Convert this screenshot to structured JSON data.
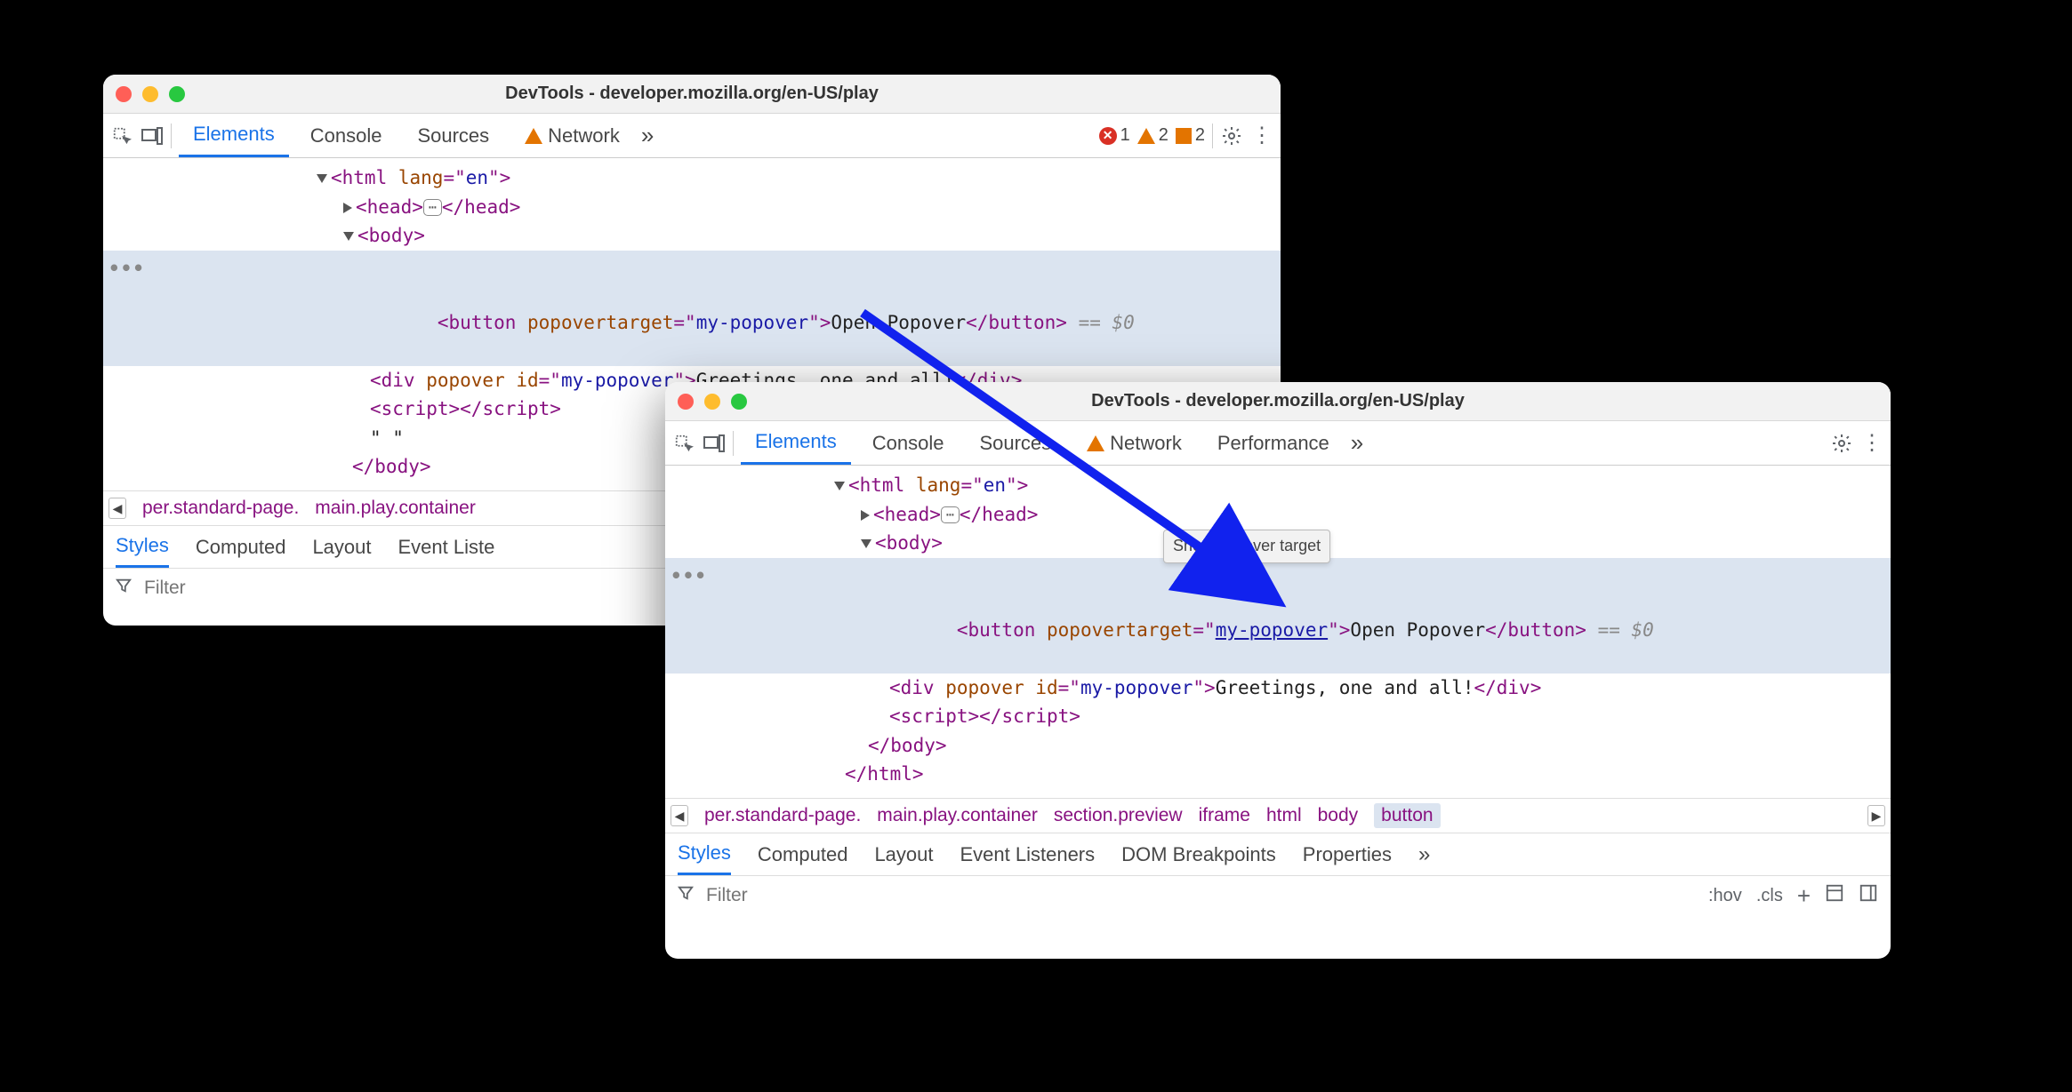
{
  "w1": {
    "title": "DevTools - developer.mozilla.org/en-US/play",
    "tabs": {
      "elements": "Elements",
      "console": "Console",
      "sources": "Sources",
      "network": "Network"
    },
    "counts": {
      "errors": "1",
      "warnings": "2",
      "issues": "2"
    },
    "dom": {
      "html_open": "<html lang=\"en\">",
      "head": "<head>",
      "head_close": "</head>",
      "body_open": "<body>",
      "button_open": "<button popovertarget=\"my-popover\">",
      "button_text": "Open Popover",
      "button_close": "</button>",
      "eq": " == $0",
      "div": "<div popover id=\"my-popover\">",
      "div_text": "Greetings, one and all!",
      "div_close": "</div>",
      "script": "<script>",
      "script_close": "</script>",
      "quote": "\" \"",
      "body_close": "</body>"
    },
    "crumbs": {
      "c1": "per.standard-page.",
      "c2": "main.play.container"
    },
    "subtabs": {
      "styles": "Styles",
      "computed": "Computed",
      "layout": "Layout",
      "ev": "Event Liste"
    },
    "filter_placeholder": "Filter"
  },
  "w2": {
    "title": "DevTools - developer.mozilla.org/en-US/play",
    "tabs": {
      "elements": "Elements",
      "console": "Console",
      "sources": "Sources",
      "network": "Network",
      "performance": "Performance"
    },
    "tooltip": "Show popover target",
    "dom": {
      "html_open": "<html lang=\"en\">",
      "head": "<head>",
      "head_close": "</head>",
      "body_open": "<body>",
      "button_pre": "<button popovertarget=\"",
      "button_link": "my-popover",
      "button_post": "\">",
      "button_text": "Open Popover",
      "button_close": "</button>",
      "eq": " == $0",
      "div": "<div popover id=\"my-popover\">",
      "div_text": "Greetings, one and all!",
      "div_close": "</div>",
      "script": "<script>",
      "script_close": "</script>",
      "body_close": "</body>",
      "html_close": "</html>"
    },
    "crumbs": {
      "c1": "per.standard-page.",
      "c2": "main.play.container",
      "c3": "section.preview",
      "c4": "iframe",
      "c5": "html",
      "c6": "body",
      "c7": "button"
    },
    "subtabs": {
      "styles": "Styles",
      "computed": "Computed",
      "layout": "Layout",
      "ev": "Event Listeners",
      "dom": "DOM Breakpoints",
      "props": "Properties"
    },
    "filter_placeholder": "Filter",
    "tools": {
      "hov": ":hov",
      "cls": ".cls"
    }
  }
}
